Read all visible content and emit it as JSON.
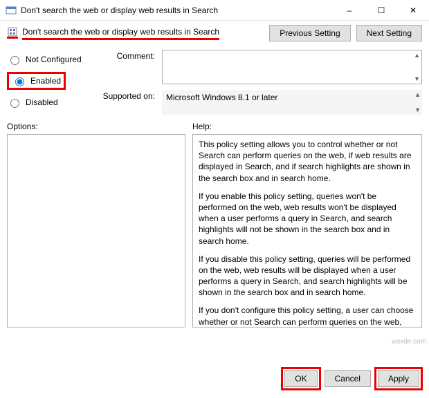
{
  "window": {
    "title": "Don't search the web or display web results in Search",
    "minimize": "–",
    "maximize": "☐",
    "close": "✕"
  },
  "header": {
    "policy_name": "Don't search the web or display web results in Search",
    "previous": "Previous Setting",
    "next": "Next Setting"
  },
  "radios": {
    "not_configured": "Not Configured",
    "enabled": "Enabled",
    "disabled": "Disabled"
  },
  "labels": {
    "comment": "Comment:",
    "supported_on": "Supported on:",
    "options": "Options:",
    "help": "Help:"
  },
  "supported_value": "Microsoft Windows 8.1 or later",
  "help": {
    "p1": "This policy setting allows you to control whether or not Search can perform queries on the web, if web results are displayed in Search, and if search highlights are shown in the search box and in search home.",
    "p2": "If you enable this policy setting, queries won't be performed on the web, web results won't be displayed when a user performs a query in Search, and search highlights will not be shown in the search box and in search home.",
    "p3": "If you disable this policy setting, queries will be performed on the web, web results will be displayed when a user performs a query in Search, and search highlights will be shown in the search box and in search home.",
    "p4": "If you don't configure this policy setting, a user can choose whether or not Search can perform queries on the web, and if the web results are displayed in Search, and if search highlights are shown in the search box and in search home."
  },
  "buttons": {
    "ok": "OK",
    "cancel": "Cancel",
    "apply": "Apply"
  },
  "watermark": "wsxdn.com"
}
